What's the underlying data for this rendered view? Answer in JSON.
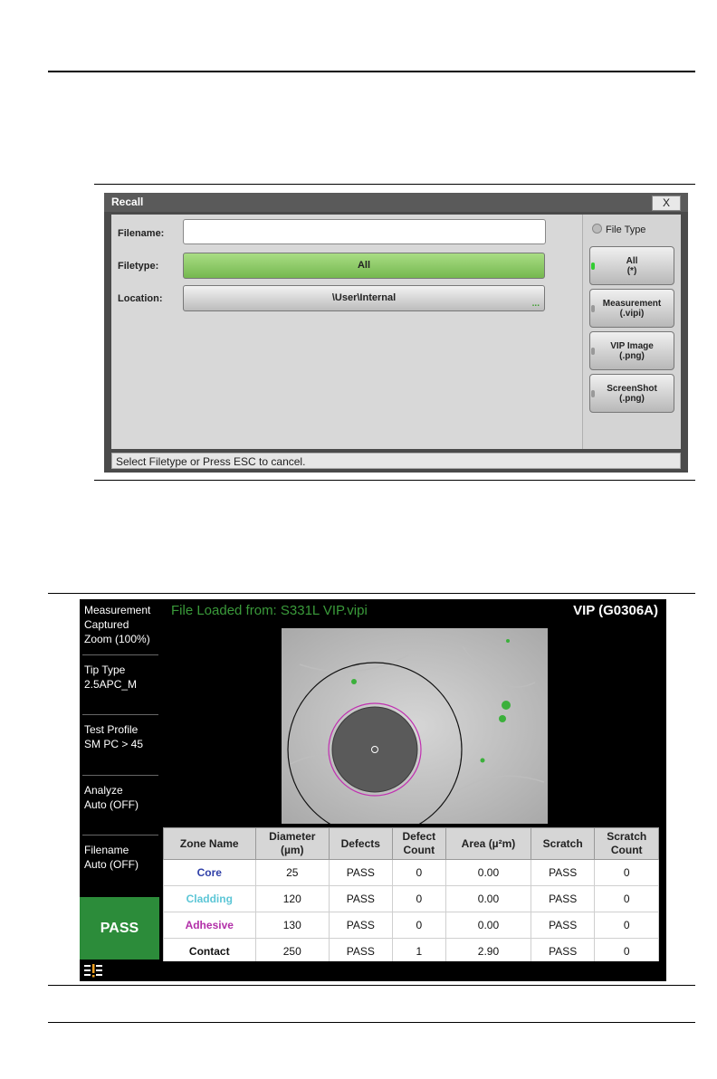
{
  "recall_dialog": {
    "title": "Recall",
    "close_label": "X",
    "filename_label": "Filename:",
    "filename_value": "",
    "filetype_label": "Filetype:",
    "filetype_value": "All",
    "location_label": "Location:",
    "location_value": "\\User\\Internal",
    "location_more": "...",
    "file_type_header": "File Type",
    "file_type_buttons": [
      {
        "line1": "All",
        "line2": "(*)",
        "selected": true
      },
      {
        "line1": "Measurement",
        "line2": "(.vipi)",
        "selected": false
      },
      {
        "line1": "VIP Image",
        "line2": "(.png)",
        "selected": false
      },
      {
        "line1": "ScreenShot",
        "line2": "(.png)",
        "selected": false
      }
    ],
    "status": "Select Filetype or Press ESC to cancel."
  },
  "vip_screen": {
    "left_panel": {
      "measurement": [
        "Measurement",
        "Captured",
        "Zoom (100%)"
      ],
      "tip_type": [
        "Tip Type",
        "2.5APC_M"
      ],
      "test_profile": [
        "Test Profile",
        "SM PC > 45"
      ],
      "analyze": [
        "Analyze",
        "Auto (OFF)"
      ],
      "filename": [
        "Filename",
        "Auto (OFF)"
      ],
      "result": "PASS"
    },
    "file_loaded": "File Loaded from: S331L VIP.vipi",
    "model": "VIP (G0306A)",
    "table": {
      "headers": [
        [
          "Zone Name"
        ],
        [
          "Diameter",
          "(µm)"
        ],
        [
          "Defects"
        ],
        [
          "Defect",
          "Count"
        ],
        [
          "Area (µ²m)"
        ],
        [
          "Scratch"
        ],
        [
          "Scratch",
          "Count"
        ]
      ],
      "rows": [
        {
          "zone": "Core",
          "diameter": "25",
          "defects": "PASS",
          "defect_count": "0",
          "area": "0.00",
          "scratch": "PASS",
          "scratch_count": "0"
        },
        {
          "zone": "Cladding",
          "diameter": "120",
          "defects": "PASS",
          "defect_count": "0",
          "area": "0.00",
          "scratch": "PASS",
          "scratch_count": "0"
        },
        {
          "zone": "Adhesive",
          "diameter": "130",
          "defects": "PASS",
          "defect_count": "0",
          "area": "0.00",
          "scratch": "PASS",
          "scratch_count": "0"
        },
        {
          "zone": "Contact",
          "diameter": "250",
          "defects": "PASS",
          "defect_count": "1",
          "area": "2.90",
          "scratch": "PASS",
          "scratch_count": "0"
        }
      ],
      "zone_colors": {
        "Core": "#2f3fa8",
        "Cladding": "#5cc6d6",
        "Adhesive": "#b22fa8",
        "Contact": "#111111"
      }
    },
    "colors": {
      "pass_green": "#2c8c3a",
      "background": "#000000"
    },
    "icons": [
      "menu-icon"
    ]
  }
}
